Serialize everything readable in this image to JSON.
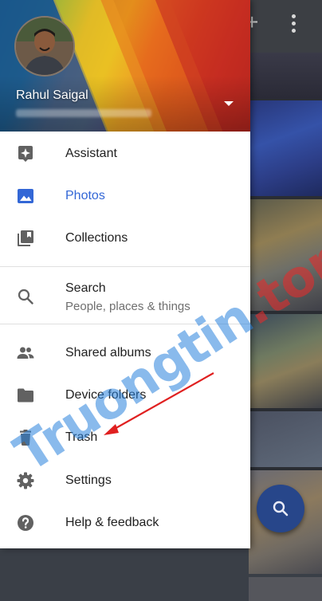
{
  "account": {
    "name": "Rahul Saigal",
    "email_hidden": ""
  },
  "menu": {
    "assistant": "Assistant",
    "photos": "Photos",
    "collections": "Collections",
    "search": "Search",
    "search_sub": "People, places & things",
    "shared_albums": "Shared albums",
    "device_folders": "Device folders",
    "trash": "Trash",
    "settings": "Settings",
    "help": "Help & feedback"
  },
  "watermark": {
    "brand": "Truongtin",
    "tld": ".top"
  },
  "colors": {
    "active": "#3367d6",
    "icon": "#616161",
    "fab": "#27468a",
    "annotation_arrow": "#e02020"
  },
  "icons": {
    "assistant": "sparkle-icon",
    "photos": "image-icon",
    "collections": "library-icon",
    "search": "search-icon",
    "shared_albums": "people-icon",
    "device_folders": "folder-icon",
    "trash": "trash-icon",
    "settings": "gear-icon",
    "help": "help-icon",
    "fab": "search-icon"
  }
}
